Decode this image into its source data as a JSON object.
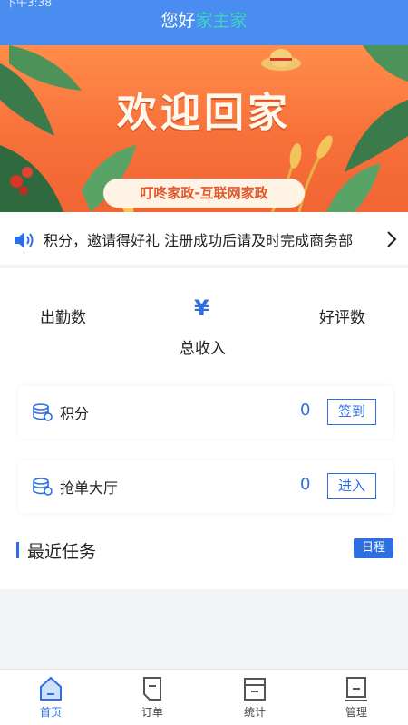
{
  "status_bar": {
    "time": "下午3:38"
  },
  "header": {
    "greeting": "您好",
    "user_name": "家主家"
  },
  "banner": {
    "title": "欢迎回家",
    "subtitle": "叮咚家政-互联网家政"
  },
  "notice": {
    "text": "积分，邀请得好礼   注册成功后请及时完成商务部"
  },
  "stats": {
    "attendance_label": "出勤数",
    "currency_symbol": "¥",
    "total_income_label": "总收入",
    "good_reviews_label": "好评数"
  },
  "entries": [
    {
      "label": "积分",
      "value": "0",
      "button": "签到"
    },
    {
      "label": "抢单大厅",
      "value": "0",
      "button": "进入"
    }
  ],
  "recent_tasks": {
    "title": "最近任务",
    "schedule_button": "日程"
  },
  "tabbar": [
    {
      "label": "首页",
      "icon": "home-icon",
      "active": true
    },
    {
      "label": "订单",
      "icon": "order-icon",
      "active": false
    },
    {
      "label": "统计",
      "icon": "stats-icon",
      "active": false
    },
    {
      "label": "管理",
      "icon": "manage-icon",
      "active": false
    }
  ],
  "colors": {
    "accent": "#2d6fe0",
    "header": "#4a8df0",
    "banner": "#f7703a"
  }
}
